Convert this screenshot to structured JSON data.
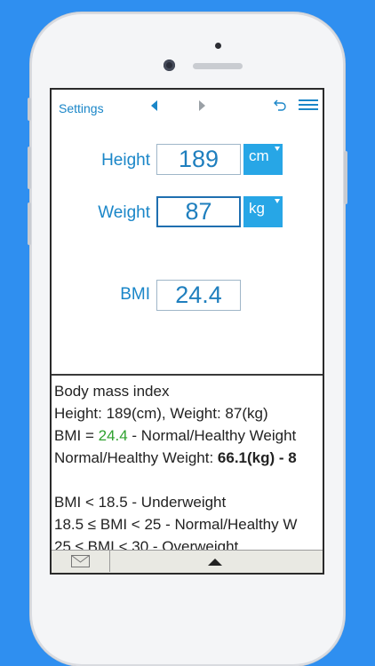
{
  "topbar": {
    "settings_label": "Settings"
  },
  "form": {
    "height": {
      "label": "Height",
      "value": "189",
      "unit": "cm"
    },
    "weight": {
      "label": "Weight",
      "value": "87",
      "unit": "kg"
    },
    "bmi": {
      "label": "BMI",
      "value": "24.4"
    }
  },
  "info": {
    "title": "Body mass index",
    "summary": "Height: 189(cm), Weight: 87(kg)",
    "bmi_prefix": "BMI = ",
    "bmi_value": "24.4",
    "bmi_suffix": " - Normal/Healthy Weight",
    "healthy_prefix": "Normal/Healthy Weight: ",
    "healthy_range": "66.1(kg) - 8",
    "ranges": [
      "BMI < 18.5 - Underweight",
      "18.5 ≤ BMI < 25 - Normal/Healthy W",
      "25 ≤ BMI < 30 - Overweight"
    ]
  },
  "colors": {
    "accent": "#1a86c8",
    "unit_bg": "#27a6e6",
    "normal_green": "#2ea12e",
    "background": "#2f8ff0"
  },
  "icons": [
    "undo-icon",
    "menu-icon",
    "mail-icon",
    "up-arrow-icon",
    "left-arrow-icon",
    "right-arrow-icon"
  ]
}
